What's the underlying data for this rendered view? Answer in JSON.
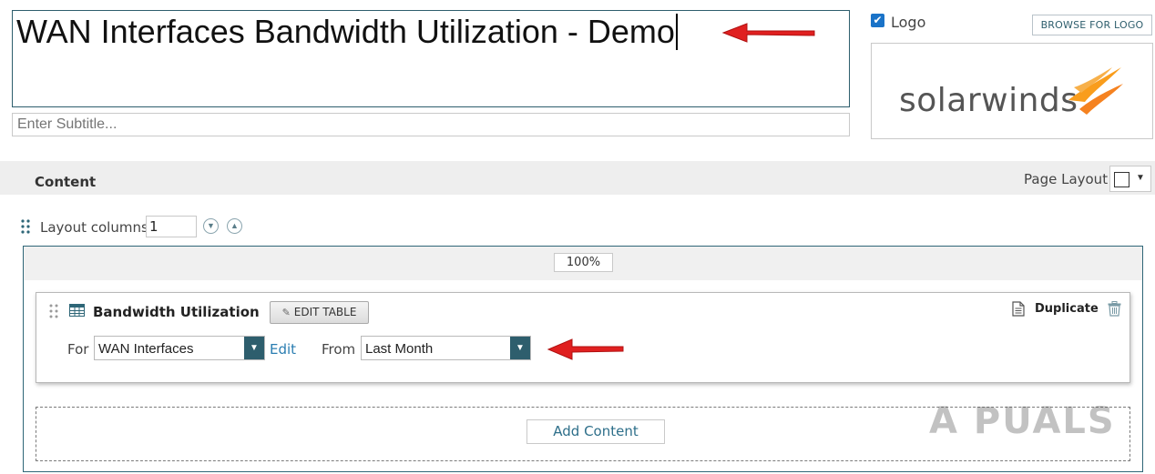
{
  "report": {
    "title": "WAN Interfaces Bandwidth Utilization - Demo",
    "subtitle_placeholder": "Enter Subtitle...",
    "subtitle_value": ""
  },
  "logo": {
    "checkbox_label": "Logo",
    "checked": true,
    "browse_label": "BROWSE FOR LOGO",
    "wordmark": "solarwinds",
    "brand_color": "#f99d1c"
  },
  "content_section": {
    "heading": "Content",
    "page_layout_label": "Page Layout"
  },
  "layout": {
    "columns_label": "Layout columns",
    "columns_value": "1",
    "column_width": "100%"
  },
  "resource": {
    "title": "Bandwidth Utilization",
    "edit_table_label": "EDIT TABLE",
    "duplicate_label": "Duplicate",
    "for_label": "For",
    "for_value": "WAN Interfaces",
    "edit_link": "Edit",
    "from_label": "From",
    "from_value": "Last Month"
  },
  "add_content_label": "Add Content",
  "watermark": "A  PUALS",
  "colors": {
    "accent": "#2e5e6d",
    "link": "#2a7db1",
    "arrow": "#e02020"
  },
  "icons": [
    "check-icon",
    "drag-handle-icon",
    "chevron-down-icon",
    "chevron-up-icon",
    "table-icon",
    "pencil-icon",
    "duplicate-icon",
    "trash-icon",
    "caret-down-icon"
  ]
}
